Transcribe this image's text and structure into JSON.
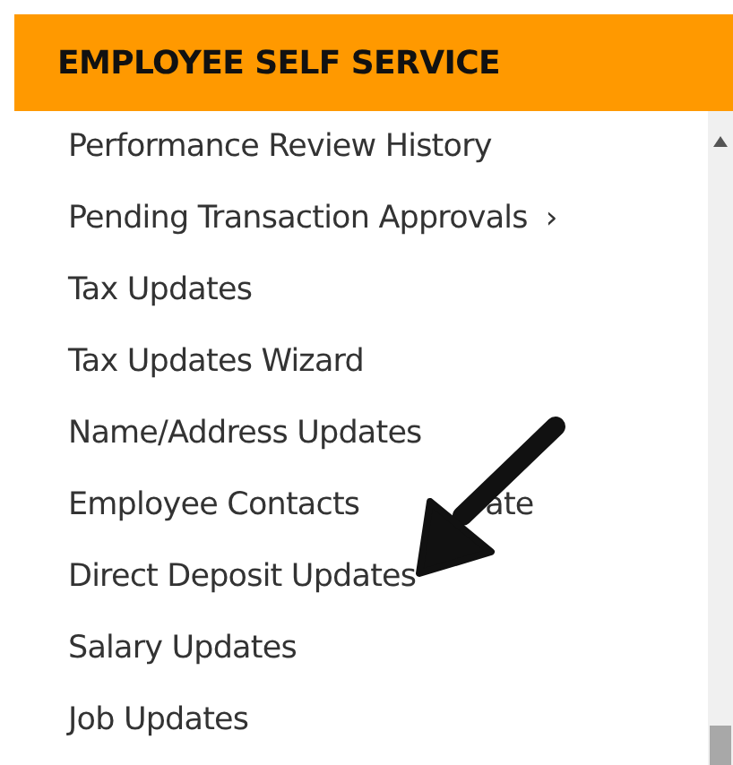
{
  "menu": {
    "title": "EMPLOYEE SELF SERVICE",
    "items": [
      {
        "label": "Performance Review History"
      },
      {
        "label": "Pending Transaction Approvals",
        "chevron": "›"
      },
      {
        "label": "Tax Updates"
      },
      {
        "label": "Tax Updates Wizard"
      },
      {
        "label": "Name/Address Updates"
      },
      {
        "label": "Employee Contacts",
        "tail": "ate"
      },
      {
        "label": "Direct Deposit Updates"
      },
      {
        "label": "Salary Updates"
      },
      {
        "label": "Job Updates"
      }
    ]
  }
}
